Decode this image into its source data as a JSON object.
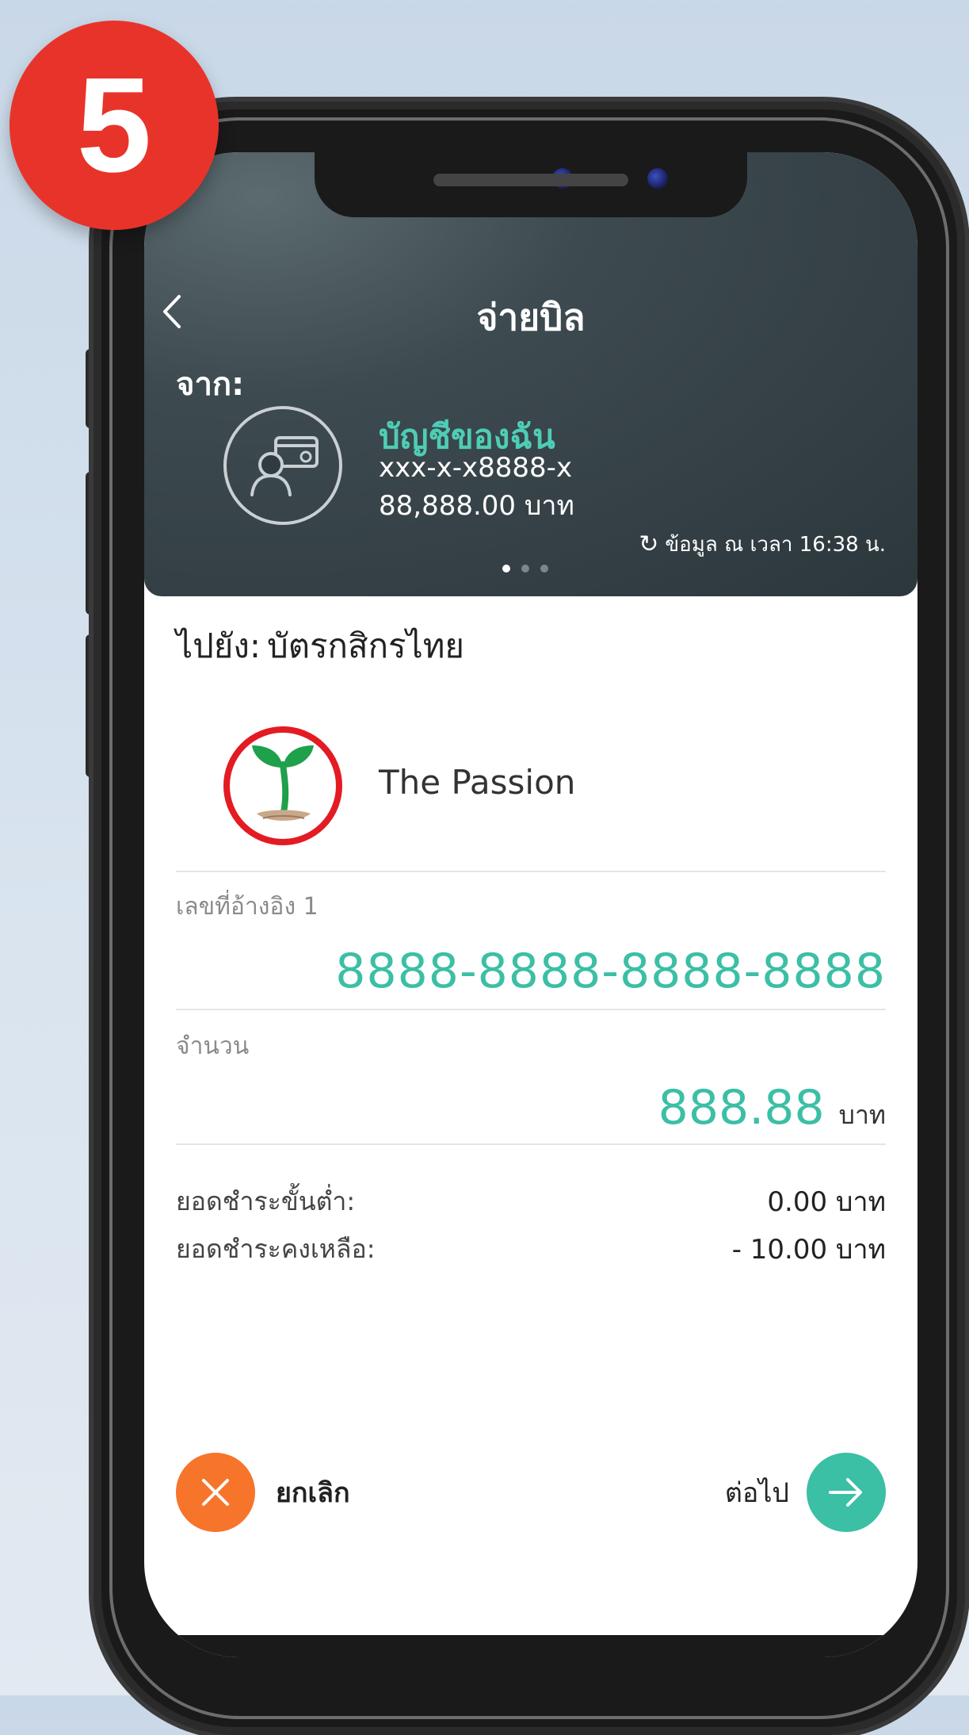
{
  "step_badge": {
    "number": "5"
  },
  "header": {
    "back_icon": "chevron-left-icon",
    "title": "จ่ายบิล",
    "from_label": "จาก:",
    "account": {
      "avatar_icon": "user-card-icon",
      "name": "บัญชีของฉัน",
      "number": "xxx-x-x8888-x",
      "balance": "88,888.00 บาท"
    },
    "refresh_icon": "refresh-icon",
    "refresh_text": "ข้อมูล ณ เวลา 16:38 น.",
    "carousel": {
      "pages": 3,
      "active": 1
    }
  },
  "to": {
    "label": "ไปยัง:",
    "value": "บัตรกสิกรไทย"
  },
  "card": {
    "logo_icon": "kasikorn-logo-icon",
    "name": "The Passion"
  },
  "reference": {
    "label": "เลขที่อ้างอิง 1",
    "value": "8888-8888-8888-8888"
  },
  "amount": {
    "label": "จำนวน",
    "value": "888.88",
    "unit": "บาท"
  },
  "summary": {
    "min_payment_label": "ยอดชำระขั้นต่ำ:",
    "min_payment_value": "0.00 บาท",
    "remaining_label": "ยอดชำระคงเหลือ:",
    "remaining_value": "- 10.00 บาท"
  },
  "actions": {
    "cancel_label": "ยกเลิก",
    "cancel_icon": "close-icon",
    "next_label": "ต่อไป",
    "next_icon": "arrow-right-icon"
  },
  "colors": {
    "accent": "#3bbfa5",
    "cancel": "#f7742b",
    "badge": "#e8332b",
    "header_bg": "#2c373c"
  }
}
